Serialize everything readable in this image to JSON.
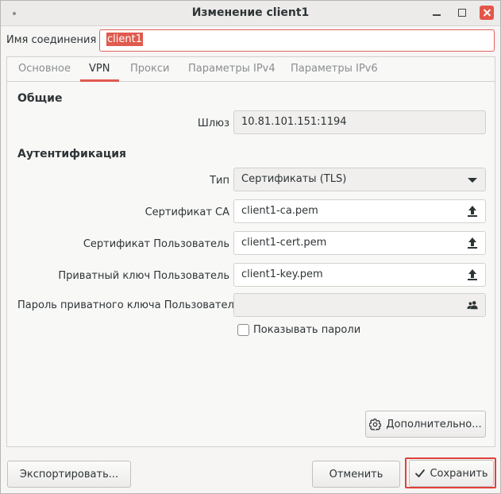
{
  "window": {
    "title": "Изменение client1"
  },
  "connection": {
    "label": "Имя соединения",
    "value": "client1"
  },
  "tabs": [
    {
      "label": "Основное"
    },
    {
      "label": "VPN"
    },
    {
      "label": "Прокси"
    },
    {
      "label": "Параметры IPv4"
    },
    {
      "label": "Параметры IPv6"
    }
  ],
  "active_tab": "VPN",
  "general": {
    "heading": "Общие",
    "gateway_label": "Шлюз",
    "gateway_value": "10.81.101.151:1194"
  },
  "auth": {
    "heading": "Аутентификация",
    "type_label": "Тип",
    "type_value": "Сертификаты (TLS)",
    "ca_label": "Сертификат CA",
    "ca_value": "client1-ca.pem",
    "user_cert_label": "Сертификат Пользователь",
    "user_cert_value": "client1-cert.pem",
    "key_label": "Приватный ключ Пользователь",
    "key_value": "client1-key.pem",
    "key_password_label": "Пароль приватного ключа Пользователь",
    "key_password_value": "",
    "show_passwords_label": "Показывать пароли",
    "show_passwords_checked": false
  },
  "buttons": {
    "advanced": "Дополнительно...",
    "export": "Экспортировать...",
    "cancel": "Отменить",
    "save": "Сохранить"
  },
  "colors": {
    "accent": "#e05a4f",
    "highlight_outline": "#e0403a"
  }
}
